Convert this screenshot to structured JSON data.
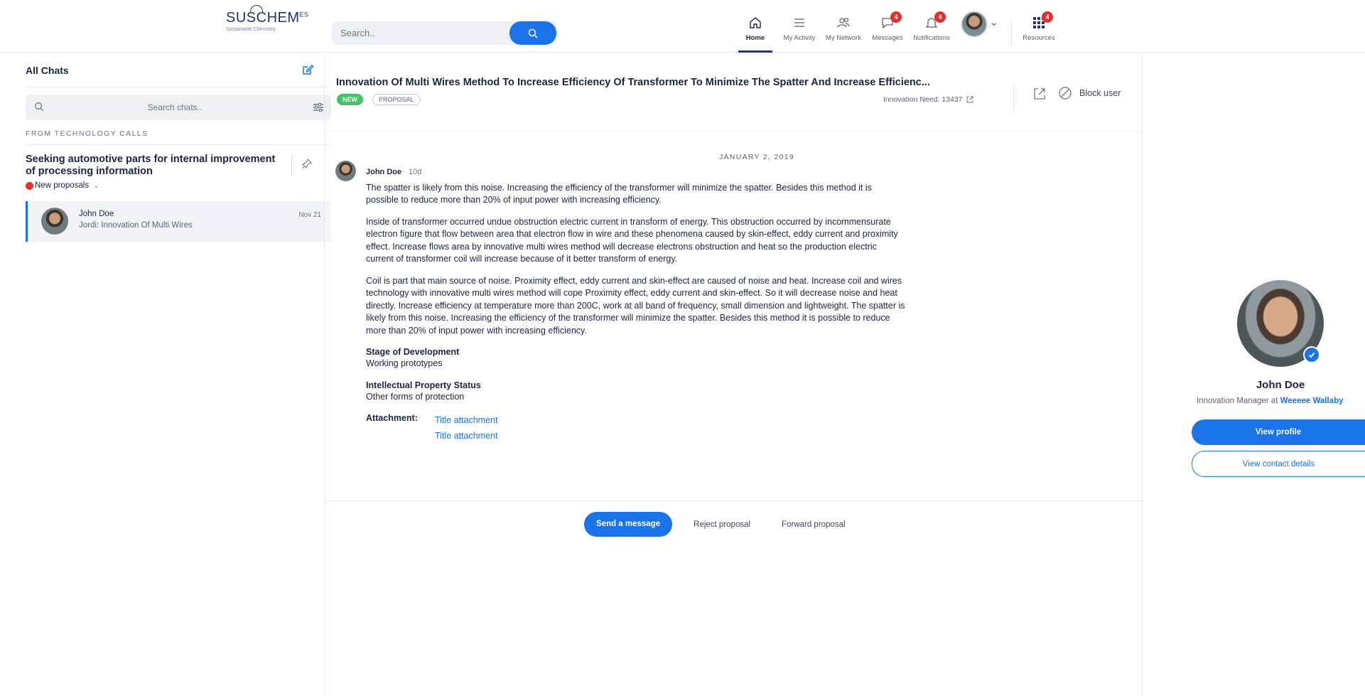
{
  "header": {
    "logo": {
      "name": "SUSCHEM",
      "superscript": "ES",
      "tagline": "Sustainable Chemistry"
    },
    "search": {
      "placeholder": "Search..",
      "button_icon": "search-icon"
    },
    "nav": [
      {
        "label": "Home",
        "icon": "home-icon",
        "active": true
      },
      {
        "label": "My Activity",
        "icon": "activity-list-icon"
      },
      {
        "label": "My Network",
        "icon": "network-icon"
      },
      {
        "label": "Messages",
        "icon": "chat-bubble-icon",
        "badge": "4"
      },
      {
        "label": "Notifications",
        "icon": "bell-icon",
        "badge": "4"
      },
      {
        "label": "Resources",
        "icon": "grid-icon",
        "badge": "4"
      }
    ],
    "avatar_menu_icon": "chevron-down-icon"
  },
  "sidebar": {
    "title": "All Chats",
    "search_placeholder": "Search chats..",
    "section_label": "FROM TECHNOLOGY CALLS",
    "call": {
      "title": "Seeking automotive parts for internal improvement of processing information",
      "status": "New proposals"
    },
    "chats": [
      {
        "name": "John Doe",
        "subtitle": "Jordi: Innovation Of Multi Wires",
        "date": "Nov 21"
      }
    ]
  },
  "conversation": {
    "title": "Innovation Of Multi Wires Method To Increase Efficiency Of Transformer To Minimize The Spatter And Increase Efficienc...",
    "tags": {
      "new": "NEW",
      "proposal": "PROPOSAL"
    },
    "need_ref": "Innovation Need: 13437",
    "block_user": "Block user",
    "date_separator": "JANUARY 2, 2019",
    "message": {
      "author": "John Doe",
      "time": "· 10d",
      "paragraphs": [
        "The spatter is likely from this noise. Increasing the efficiency of the transformer will minimize the spatter. Besides this method it is possible to reduce more than 20% of input power with increasing efficiency.",
        "Inside of transformer occurred undue obstruction electric current in transform of energy. This obstruction occurred by incommensurate electron figure that flow between area that electron flow in wire and these phenomena caused by skin-effect, eddy current and proximity effect. Increase flows area by innovative multi wires method will decrease electrons obstruction and heat so the production electric current of transformer coil will increase because of it better transform of energy.",
        "Coil is part that main source of noise. Proximity effect, eddy current and skin-effect are caused of noise and heat. Increase coil and wires technology with innovative multi wires method will cope Proximity effect, eddy current and skin-effect. So it will decrease noise and heat directly. Increase efficiency at temperature more than 200C, work at all band of frequency, small dimension and lightweight. The spatter is likely from this noise. Increasing the efficiency of the transformer will minimize the spatter. Besides this method it is possible to reduce more than 20% of input power with increasing efficiency."
      ],
      "stage_label": "Stage of Development",
      "stage_value": "Working prototypes",
      "ip_label": "Intellectual Property Status",
      "ip_value": "Other forms of protection",
      "attachment_label": "Attachment:",
      "attachments": [
        "Title attachment",
        "Title attachment"
      ]
    },
    "actions": {
      "send": "Send a message",
      "reject": "Reject proposal",
      "forward": "Forward proposal"
    }
  },
  "profile": {
    "name": "John Doe",
    "role_prefix": "Innovation Manager at ",
    "company": "Weeeee Wallaby",
    "view_profile": "View profile",
    "view_contact": "View contact details"
  },
  "colors": {
    "accent": "#1a73e8",
    "brand": "#22366b",
    "badge": "#e03131",
    "new_tag": "#45c36b"
  }
}
